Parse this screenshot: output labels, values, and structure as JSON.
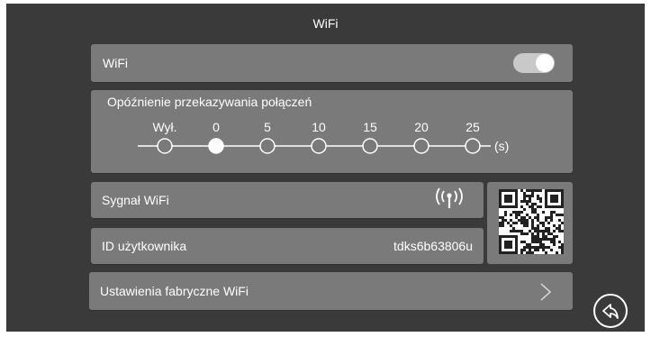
{
  "screen": {
    "title": "WiFi"
  },
  "wifi_row": {
    "label": "WiFi",
    "toggle_on": true
  },
  "delay_row": {
    "label": "Opóźnienie przekazywania połączeń",
    "options": [
      "Wył.",
      "0",
      "5",
      "10",
      "15",
      "20",
      "25"
    ],
    "selected_index": 1,
    "unit": "(s)"
  },
  "signal_row": {
    "label": "Sygnał WiFi",
    "icon": "wifi-signal-icon"
  },
  "user_row": {
    "label": "ID użytkownika",
    "value": "tdks6b63806u"
  },
  "qr": {
    "icon": "qr-code-icon"
  },
  "factory_row": {
    "label": "Ustawienia fabryczne WiFi",
    "icon": "chevron-right-icon"
  },
  "back": {
    "icon": "back-arrow-icon"
  },
  "colors": {
    "background": "#3a3a3a",
    "card": "#7a7a7a",
    "text": "#ffffff",
    "toggle_track": "#c9c9c9"
  }
}
